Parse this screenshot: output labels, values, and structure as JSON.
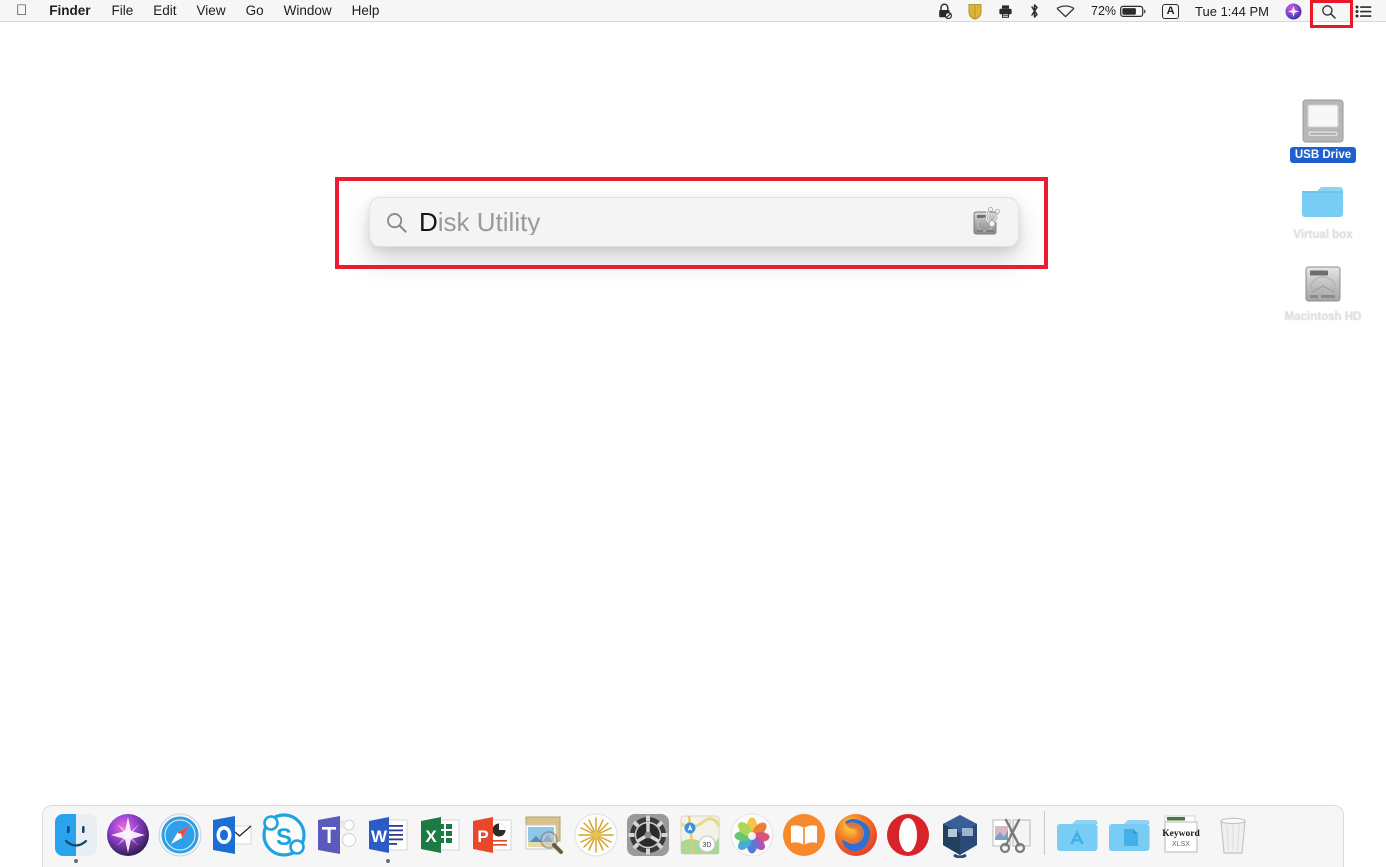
{
  "menubar": {
    "apple_icon": "apple-logo-icon",
    "items": [
      {
        "label": "Finder",
        "bold": true
      },
      {
        "label": "File",
        "bold": false
      },
      {
        "label": "Edit",
        "bold": false
      },
      {
        "label": "View",
        "bold": false
      },
      {
        "label": "Go",
        "bold": false
      },
      {
        "label": "Window",
        "bold": false
      },
      {
        "label": "Help",
        "bold": false
      }
    ],
    "status": {
      "lock_icon": "lock-disabled-icon",
      "shield_icon": "shield-icon",
      "printer_icon": "printer-icon",
      "bluetooth_icon": "bluetooth-icon",
      "wifi_icon": "wifi-icon",
      "battery_percent": "72%",
      "battery_icon": "battery-icon",
      "input_source": "A",
      "clock": "Tue 1:44 PM",
      "siri_icon": "siri-icon",
      "spotlight_icon": "search-icon",
      "control_center_icon": "control-center-icon"
    }
  },
  "spotlight": {
    "search_icon": "search-icon",
    "typed_text": "D",
    "suggested_text": "isk Utility",
    "full_query": "Disk Utility",
    "result_icon": "disk-utility-icon",
    "annotation_color": "#ed1b2e"
  },
  "desktop": {
    "icons": [
      {
        "label": "USB Drive",
        "icon": "external-drive-icon",
        "selected": true
      },
      {
        "label": "Virtual box",
        "icon": "folder-icon",
        "selected": false
      },
      {
        "label": "Macintosh HD",
        "icon": "internal-drive-icon",
        "selected": false
      }
    ]
  },
  "dock": {
    "apps": [
      {
        "name": "Finder",
        "icon": "finder-icon",
        "running": true
      },
      {
        "name": "Siri",
        "icon": "siri-icon",
        "running": false
      },
      {
        "name": "Safari",
        "icon": "safari-icon",
        "running": false
      },
      {
        "name": "Outlook",
        "icon": "outlook-icon",
        "running": false
      },
      {
        "name": "Skype",
        "icon": "skype-icon",
        "running": false
      },
      {
        "name": "Microsoft Teams",
        "icon": "teams-icon",
        "running": false
      },
      {
        "name": "Microsoft Word",
        "icon": "word-icon",
        "running": true
      },
      {
        "name": "Microsoft Excel",
        "icon": "excel-icon",
        "running": false
      },
      {
        "name": "Microsoft PowerPoint",
        "icon": "powerpoint-icon",
        "running": false
      },
      {
        "name": "Preview",
        "icon": "preview-icon",
        "running": false
      },
      {
        "name": "Firework",
        "icon": "starburst-icon",
        "running": false
      },
      {
        "name": "System Preferences",
        "icon": "system-preferences-icon",
        "running": false
      },
      {
        "name": "Maps",
        "icon": "maps-icon",
        "running": false
      },
      {
        "name": "Photos",
        "icon": "photos-icon",
        "running": false
      },
      {
        "name": "Books",
        "icon": "books-icon",
        "running": false
      },
      {
        "name": "Firefox",
        "icon": "firefox-icon",
        "running": false
      },
      {
        "name": "Opera",
        "icon": "opera-icon",
        "running": false
      },
      {
        "name": "VirtualBox",
        "icon": "virtualbox-icon",
        "running": false
      },
      {
        "name": "Grab",
        "icon": "scissors-snip-icon",
        "running": false
      }
    ],
    "stacks": [
      {
        "name": "Applications",
        "icon": "applications-folder-icon",
        "label": ""
      },
      {
        "name": "Documents",
        "icon": "documents-folder-icon",
        "label": ""
      },
      {
        "name": "Keyword",
        "icon": "xlsx-file-icon",
        "label": "Keyword",
        "sublabel": "XLSX"
      },
      {
        "name": "Trash",
        "icon": "trash-icon",
        "label": ""
      }
    ]
  }
}
